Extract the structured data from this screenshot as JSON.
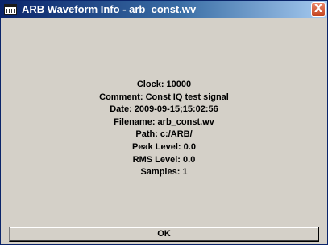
{
  "window": {
    "title": "ARB Waveform Info - arb_const.wv",
    "close_glyph": "X"
  },
  "info": {
    "clock": "Clock: 10000",
    "comment": "Comment: Const IQ test signal",
    "date": "Date: 2009-09-15;15:02:56",
    "filename": "Filename: arb_const.wv",
    "path": "Path: c:/ARB/",
    "peak_level": "Peak Level: 0.0",
    "rms_level": "RMS Level: 0.0",
    "samples": "Samples: 1"
  },
  "buttons": {
    "ok_label": "OK"
  },
  "icons": {
    "app_icon": "waveform-window-icon",
    "close_icon": "close-icon"
  },
  "colors": {
    "titlebar_start": "#0a246a",
    "titlebar_end": "#a6caf0",
    "dialog_background": "#d4d0c8",
    "close_button": "#c2431f"
  }
}
